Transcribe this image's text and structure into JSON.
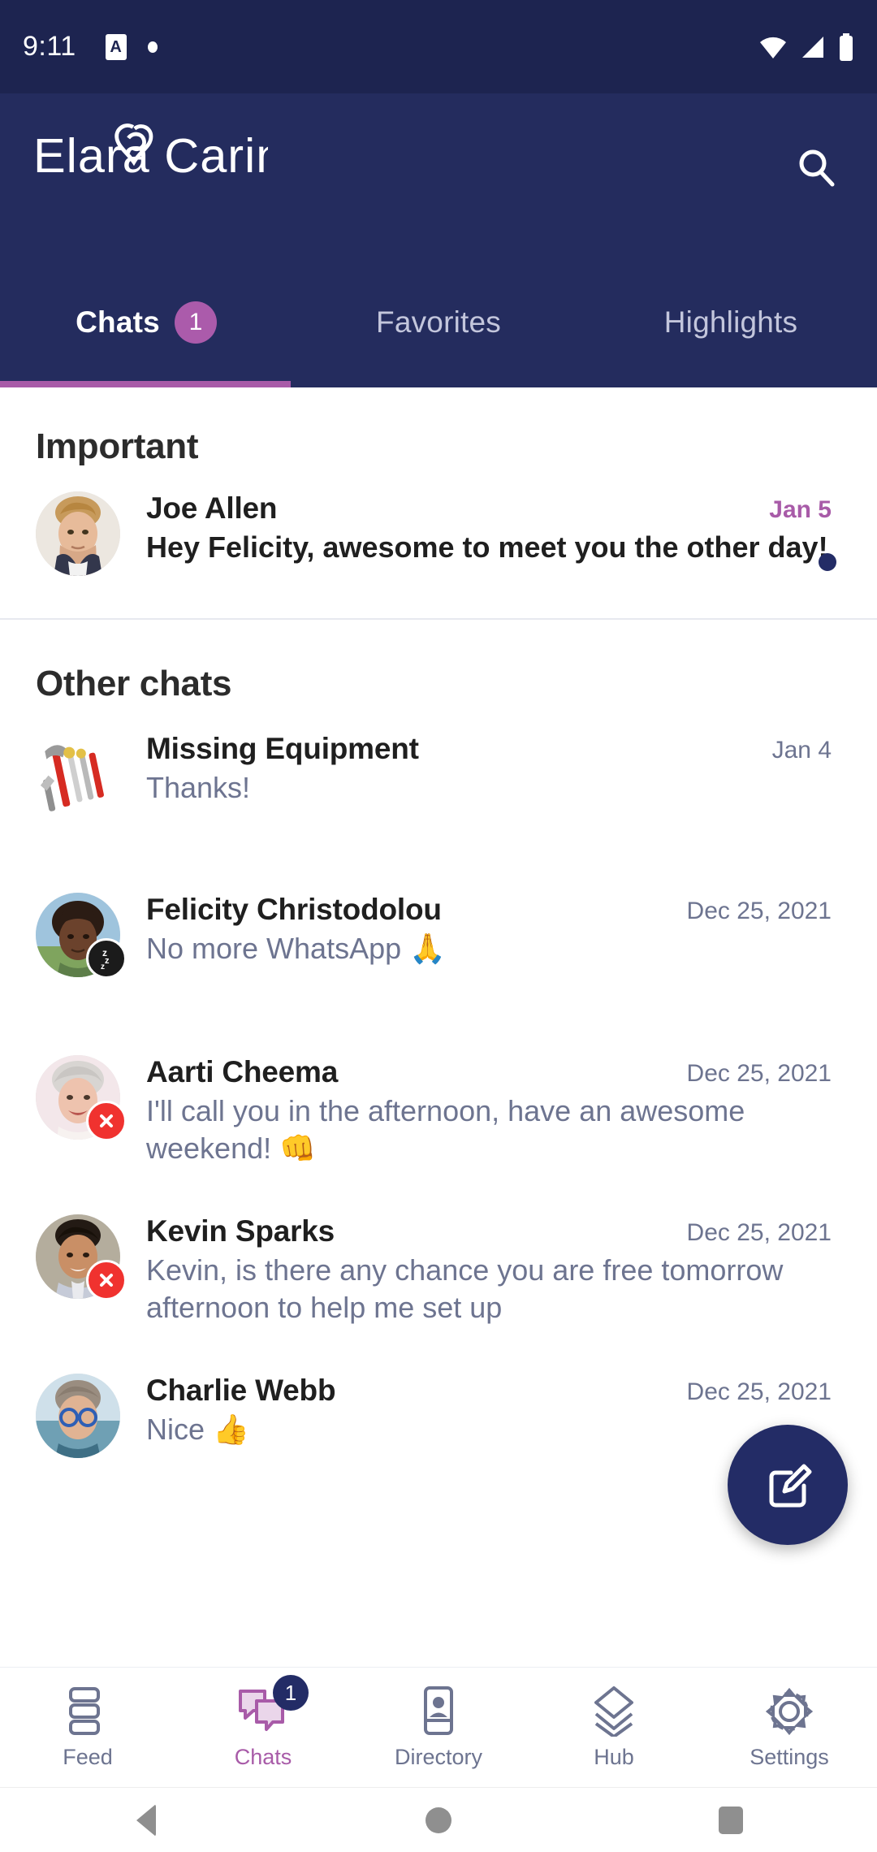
{
  "status_bar": {
    "time": "9:11",
    "app_icon_letter": "A",
    "icons": [
      "app-notification-icon",
      "dot-icon",
      "wifi-icon",
      "cellular-signal-icon",
      "battery-icon"
    ]
  },
  "app_bar": {
    "brand": "Elara Caring",
    "brand_word_1": "Elara",
    "brand_word_2": "Caring",
    "search_label": "Search"
  },
  "tabs": [
    {
      "label": "Chats",
      "badge": "1",
      "active": true
    },
    {
      "label": "Favorites",
      "badge": "",
      "active": false
    },
    {
      "label": "Highlights",
      "badge": "",
      "active": false
    }
  ],
  "sections": [
    {
      "title": "Important",
      "rows": [
        {
          "name": "Joe Allen",
          "preview": "Hey Felicity, awesome to meet you the other day!",
          "date": "Jan 5",
          "unread": true,
          "status_badge": "",
          "avatar": "photo-man-blond"
        }
      ]
    },
    {
      "title": "Other chats",
      "rows": [
        {
          "name": "Missing Equipment",
          "preview": "Thanks!",
          "date": "Jan 4",
          "unread": false,
          "status_badge": "",
          "avatar": "photo-tools"
        },
        {
          "name": "Felicity Christodolou",
          "preview": "No more WhatsApp 🙏",
          "date": "Dec 25, 2021",
          "unread": false,
          "status_badge": "snooze",
          "avatar": "photo-woman-curly"
        },
        {
          "name": "Aarti Cheema",
          "preview": "I'll call you in the afternoon, have an awesome weekend! 👊",
          "date": "Dec 25, 2021",
          "unread": false,
          "status_badge": "dnd",
          "avatar": "photo-woman-silver"
        },
        {
          "name": "Kevin Sparks",
          "preview": "Kevin, is there any chance you are free tomorrow afternoon to help me set up",
          "date": "Dec 25, 2021",
          "unread": false,
          "status_badge": "dnd",
          "avatar": "photo-man-dark"
        },
        {
          "name": "Charlie Webb",
          "preview": "Nice 👍",
          "date": "Dec 25, 2021",
          "unread": false,
          "status_badge": "",
          "avatar": "photo-man-glasses"
        }
      ]
    }
  ],
  "fab": {
    "label": "Compose",
    "icon": "compose-icon"
  },
  "bottom_nav": [
    {
      "label": "Feed",
      "icon": "feed-icon",
      "badge": "",
      "active": false
    },
    {
      "label": "Chats",
      "icon": "chats-icon",
      "badge": "1",
      "active": true
    },
    {
      "label": "Directory",
      "icon": "directory-icon",
      "badge": "",
      "active": false
    },
    {
      "label": "Hub",
      "icon": "hub-icon",
      "badge": "",
      "active": false
    },
    {
      "label": "Settings",
      "icon": "settings-icon",
      "badge": "",
      "active": false
    }
  ],
  "android_nav": {
    "back": "Back",
    "home": "Home",
    "recents": "Recents"
  },
  "colors": {
    "status_bar": "#1d2450",
    "app_bar": "#242c5e",
    "accent_purple": "#a85ba8",
    "fab_navy": "#232c66",
    "muted_text": "#6d7490",
    "dnd_red": "#f0322f"
  }
}
